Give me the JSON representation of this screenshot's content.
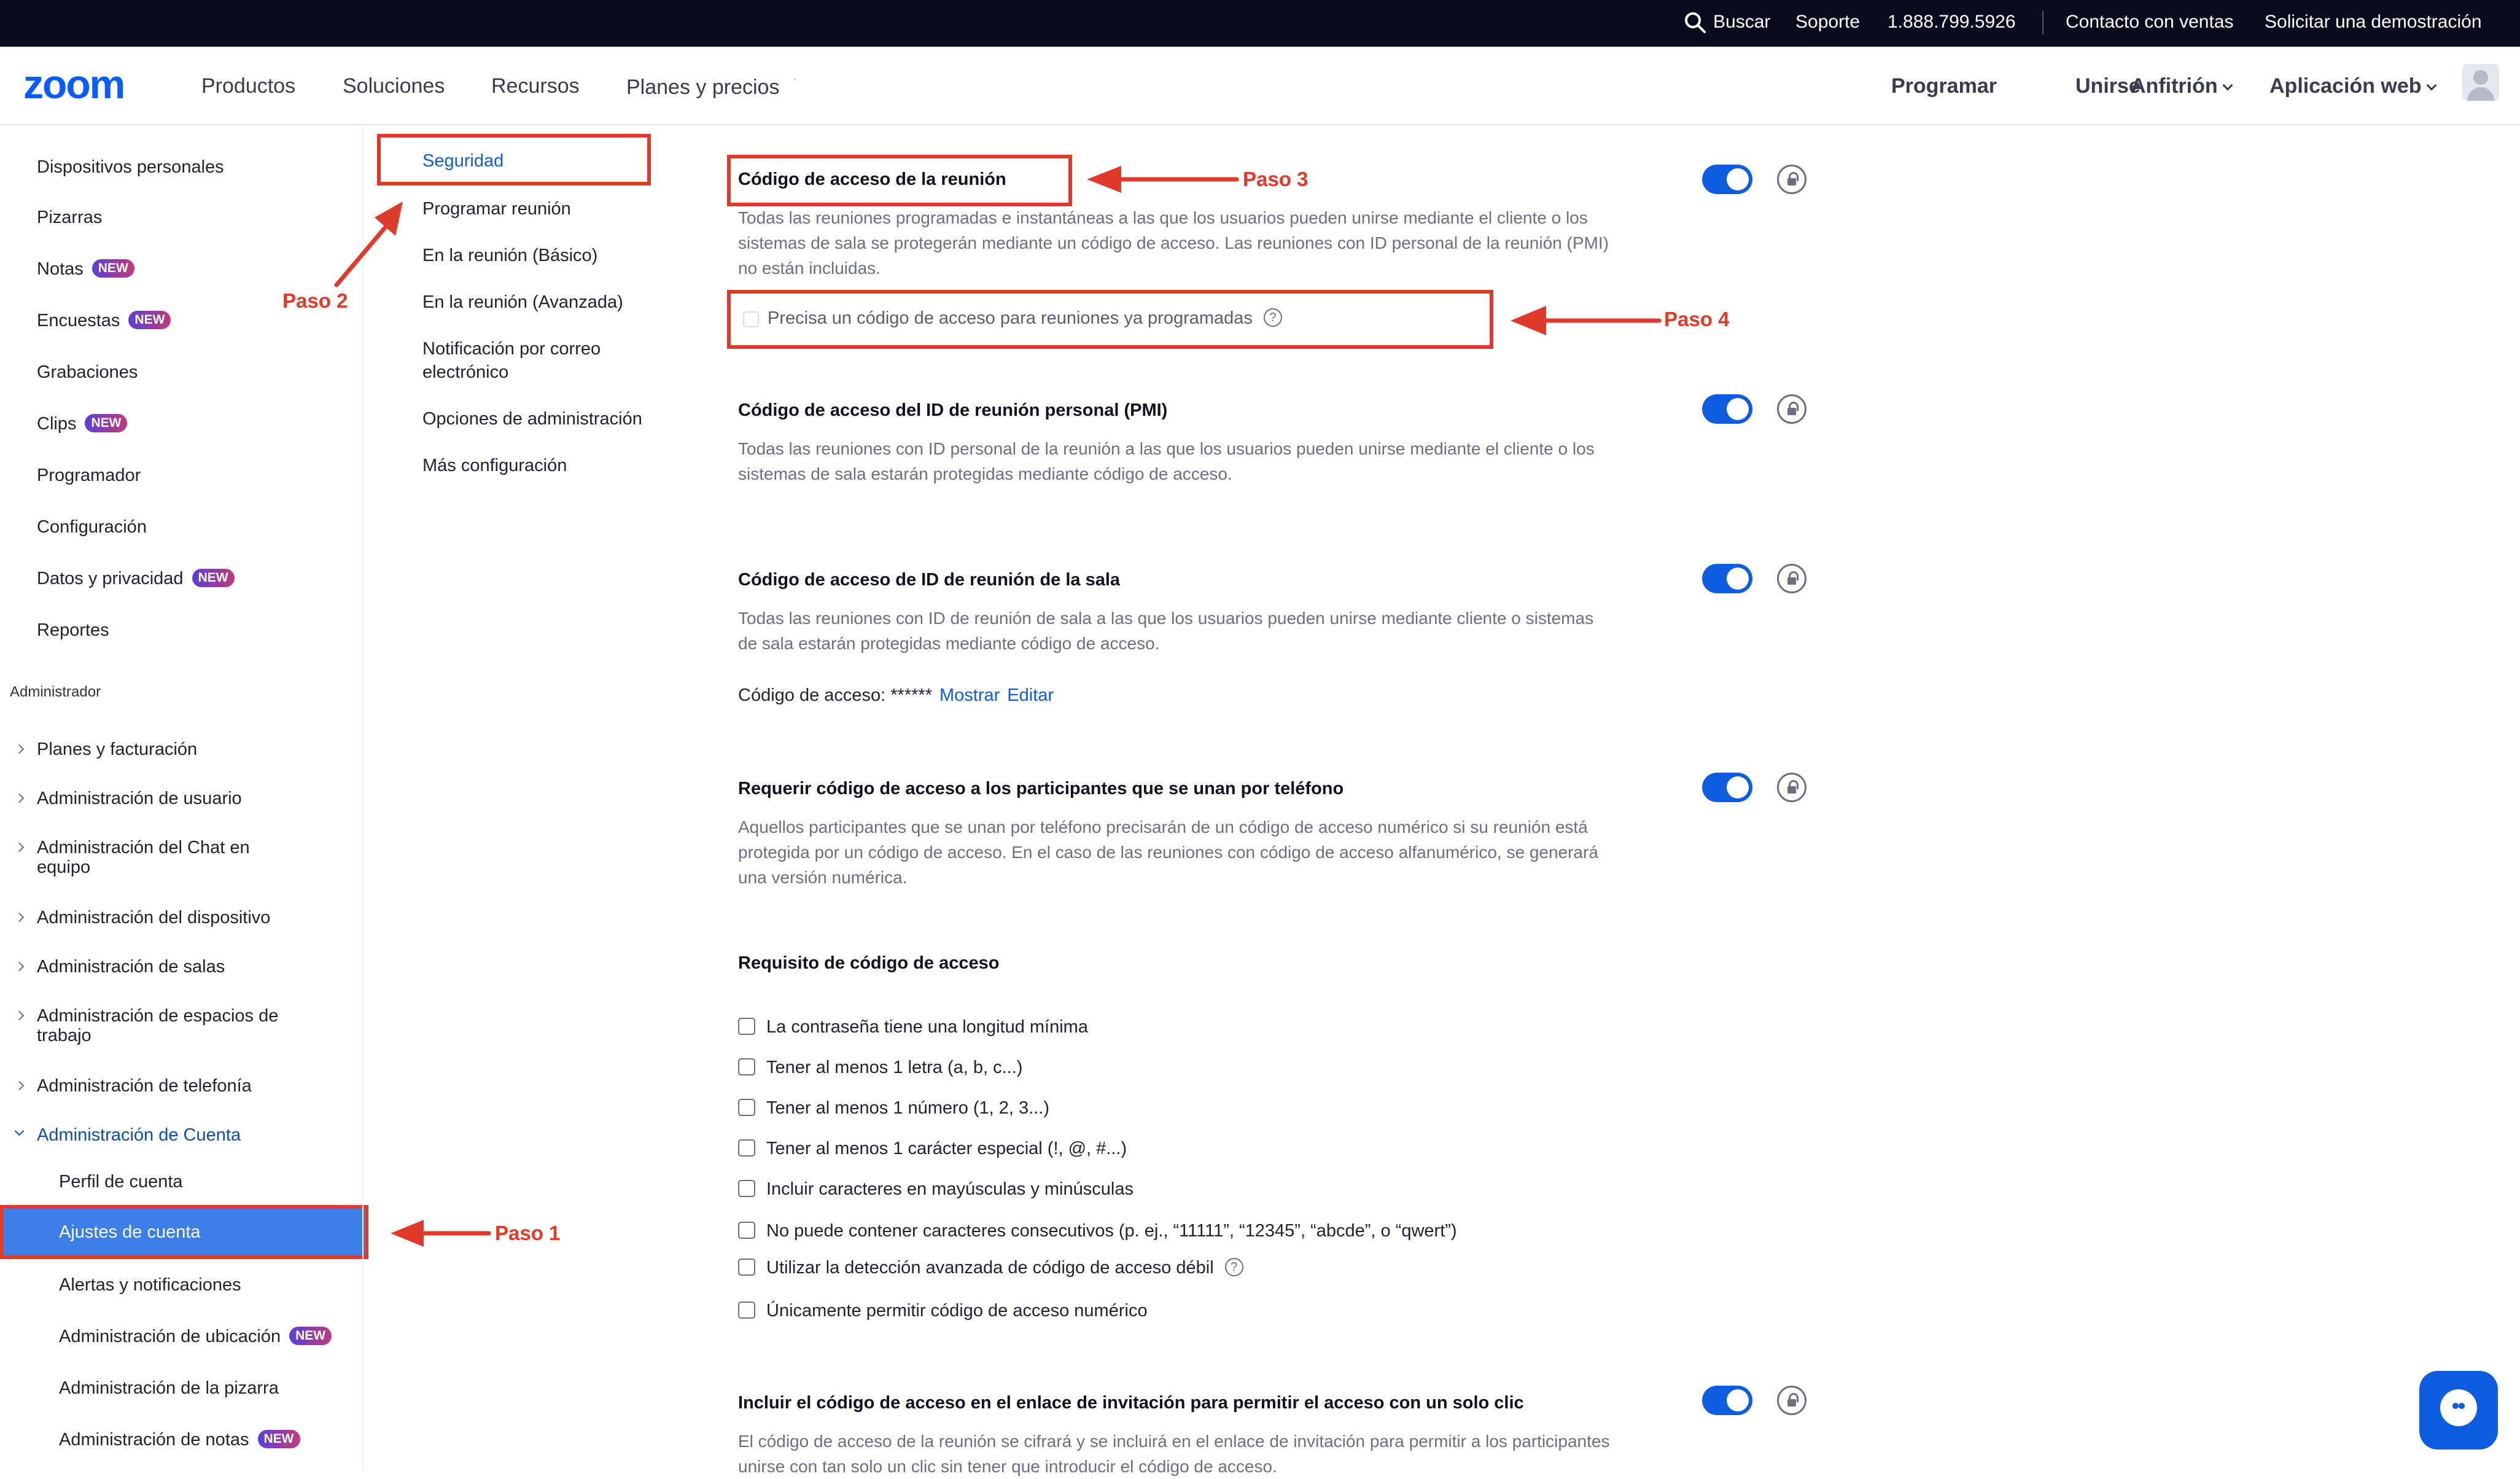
{
  "topbar": {
    "search": "Buscar",
    "support": "Soporte",
    "phone": "1.888.799.5926",
    "sales": "Contacto con ventas",
    "demo": "Solicitar una demostración"
  },
  "nav": {
    "logo": "zoom",
    "items": [
      "Productos",
      "Soluciones",
      "Recursos",
      "Planes y precios"
    ],
    "right": [
      "Programar",
      "Unirse",
      "Anfitrión",
      "Aplicación web"
    ]
  },
  "sidebar": {
    "items": [
      "Dispositivos personales",
      "Pizarras",
      "Notas",
      "Encuestas",
      "Grabaciones",
      "Clips",
      "Programador",
      "Configuración",
      "Datos y privacidad",
      "Reportes"
    ],
    "badge": "NEW",
    "admin_header": "Administrador",
    "admin_items": [
      "Planes y facturación",
      "Administración de usuario",
      "Administración del Chat en",
      "equipo",
      "Administración del dispositivo",
      "Administración de salas",
      "Administración de espacios de",
      "trabajo",
      "Administración de telefonía",
      "Administración de Cuenta"
    ],
    "account_sub": [
      "Perfil de cuenta",
      "Ajustes de cuenta",
      "Alertas y notificaciones",
      "Administración de ubicación",
      "Administración de la pizarra",
      "Administración de notas"
    ]
  },
  "col2": {
    "items": [
      "Seguridad",
      "Programar reunión",
      "En la reunión (Básico)",
      "En la reunión (Avanzada)",
      "Notificación por correo",
      "electrónico",
      "Opciones de administración",
      "Más configuración"
    ]
  },
  "settings": {
    "s1_title": "Código de acceso de la reunión",
    "s1_desc": "Todas las reuniones programadas e instantáneas a las que los usuarios pueden unirse mediante el cliente o los sistemas de sala se protegerán mediante un código de acceso. Las reuniones con ID personal de la reunión (PMI) no están incluidas.",
    "s1_option": "Precisa un código de acceso para reuniones ya programadas",
    "s2_title": "Código de acceso del ID de reunión personal (PMI)",
    "s2_desc": "Todas las reuniones con ID personal de la reunión a las que los usuarios pueden unirse mediante el cliente o los sistemas de sala estarán protegidas mediante código de acceso.",
    "s3_title": "Código de acceso de ID de reunión de la sala",
    "s3_desc": "Todas las reuniones con ID de reunión de sala a las que los usuarios pueden unirse mediante cliente o sistemas de sala estarán protegidas mediante código de acceso.",
    "s3_code_label": "Código de acceso: ******",
    "s3_show": "Mostrar",
    "s3_edit": "Editar",
    "s4_title": "Requerir código de acceso a los participantes que se unan por teléfono",
    "s4_desc": "Aquellos participantes que se unan por teléfono precisarán de un código de acceso numérico si su reunión está protegida por un código de acceso. En el caso de las reuniones con código de acceso alfanumérico, se generará una versión numérica.",
    "req_title": "Requisito de código de acceso",
    "req_items": [
      "La contraseña tiene una longitud mínima",
      "Tener al menos 1 letra (a, b, c...)",
      "Tener al menos 1 número (1, 2, 3...)",
      "Tener al menos 1 carácter especial (!, @, #...)",
      "Incluir caracteres en mayúsculas y minúsculas",
      "No puede contener caracteres consecutivos (p. ej., “11111”, “12345”, “abcde”, o “qwert”)",
      "Utilizar la detección avanzada de código de acceso débil",
      "Únicamente permitir código de acceso numérico"
    ],
    "s5_title": "Incluir el código de acceso en el enlace de invitación para permitir el acceso con un solo clic",
    "s5_desc": "El código de acceso de la reunión se cifrará y se incluirá en el enlace de invitación para permitir a los participantes unirse con tan solo un clic sin tener que introducir el código de acceso."
  },
  "annotations": {
    "paso1": "Paso 1",
    "paso2": "Paso 2",
    "paso3": "Paso 3",
    "paso4": "Paso 4",
    "color": "#e03a2a"
  },
  "help_glyph": "?"
}
